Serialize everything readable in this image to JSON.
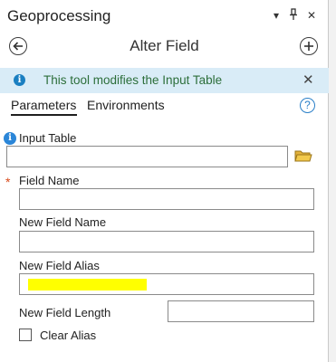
{
  "window": {
    "title": "Geoprocessing",
    "controls": {
      "dropdown": "▾",
      "pin": "⊥",
      "close": "✕"
    }
  },
  "tool": {
    "title": "Alter Field"
  },
  "banner": {
    "text": "This tool modifies the Input Table",
    "close": "✕"
  },
  "tabs": [
    {
      "label": "Parameters",
      "active": true
    },
    {
      "label": "Environments",
      "active": false
    }
  ],
  "help": {
    "glyph": "?"
  },
  "params": {
    "input_table": {
      "label": "Input Table",
      "value": ""
    },
    "field_name": {
      "label": "Field Name",
      "value": "",
      "required": true
    },
    "new_field_name": {
      "label": "New Field Name",
      "value": ""
    },
    "new_field_alias": {
      "label": "New Field Alias",
      "value": ""
    },
    "new_field_length": {
      "label": "New Field Length",
      "value": ""
    },
    "clear_alias": {
      "label": "Clear Alias",
      "checked": false
    }
  },
  "glyphs": {
    "info": "i",
    "required": "*"
  },
  "colors": {
    "banner_bg": "#d9ecf7",
    "banner_text": "#2c6e3a",
    "info_blue": "#2b86d8",
    "required_red": "#d84a1b",
    "highlight_yellow": "#ffff00"
  },
  "icons": [
    "back-arrow-icon",
    "add-icon",
    "info-icon",
    "close-icon",
    "help-icon",
    "folder-icon",
    "pin-icon",
    "chevron-down-icon"
  ]
}
